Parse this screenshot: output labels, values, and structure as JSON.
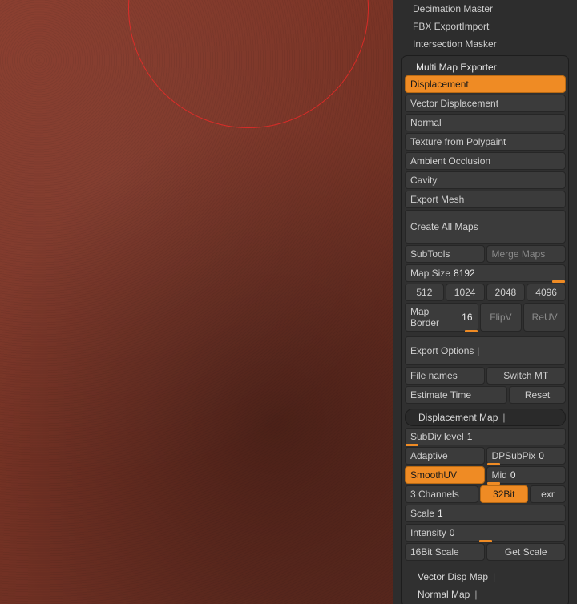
{
  "plugins": {
    "decimation": "Decimation Master",
    "fbx": "FBX ExportImport",
    "intersection": "Intersection Masker",
    "mme": "Multi Map Exporter"
  },
  "mapButtons": {
    "displacement": "Displacement",
    "vectorDisp": "Vector Displacement",
    "normal": "Normal",
    "texture": "Texture from Polypaint",
    "ao": "Ambient Occlusion",
    "cavity": "Cavity",
    "exportMesh": "Export Mesh"
  },
  "actions": {
    "createAll": "Create All Maps",
    "subtools": "SubTools",
    "mergeMaps": "Merge Maps",
    "fileNames": "File names",
    "switchMT": "Switch MT",
    "estimate": "Estimate Time",
    "reset": "Reset",
    "getScale": "Get Scale",
    "sixteenBitScale": "16Bit Scale"
  },
  "mapSize": {
    "label": "Map Size",
    "value": "8192",
    "p512": "512",
    "p1024": "1024",
    "p2048": "2048",
    "p4096": "4096"
  },
  "border": {
    "label": "Map Border",
    "value": "16",
    "flipv": "FlipV",
    "reuv": "ReUV"
  },
  "sections": {
    "exportOptions": "Export Options",
    "dispMap": "Displacement Map",
    "vectorDispMap": "Vector Disp Map",
    "normalMap": "Normal Map"
  },
  "disp": {
    "subdivLabel": "SubDiv level",
    "subdivValue": "1",
    "adaptive": "Adaptive",
    "dpSubPixLabel": "DPSubPix",
    "dpSubPixValue": "0",
    "smoothUV": "SmoothUV",
    "midLabel": "Mid",
    "midValue": "0",
    "channels": "3 Channels",
    "bit32": "32Bit",
    "exr": "exr",
    "scaleLabel": "Scale",
    "scaleValue": "1",
    "intensityLabel": "Intensity",
    "intensityValue": "0"
  },
  "bar": "|"
}
